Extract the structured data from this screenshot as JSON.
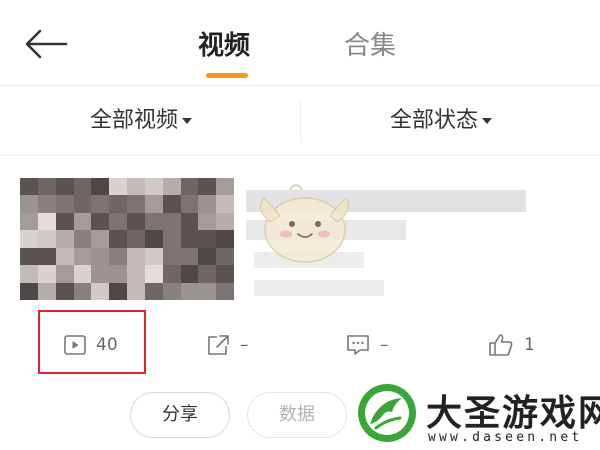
{
  "header": {
    "tabs": [
      {
        "label": "视频",
        "active": true
      },
      {
        "label": "合集",
        "active": false
      }
    ]
  },
  "filters": {
    "video_type": "全部视频",
    "status": "全部状态"
  },
  "video": {
    "stats": {
      "plays": "40",
      "shares": "–",
      "comments": "–",
      "likes": "1"
    }
  },
  "actions": {
    "share_label": "分享",
    "data_label": "数据"
  },
  "watermark": {
    "title": "大圣游戏网",
    "url": "www.daseen.net"
  },
  "colors": {
    "accent": "#f09a18",
    "highlight": "#e0262a",
    "watermark_green": "#3aa639"
  }
}
